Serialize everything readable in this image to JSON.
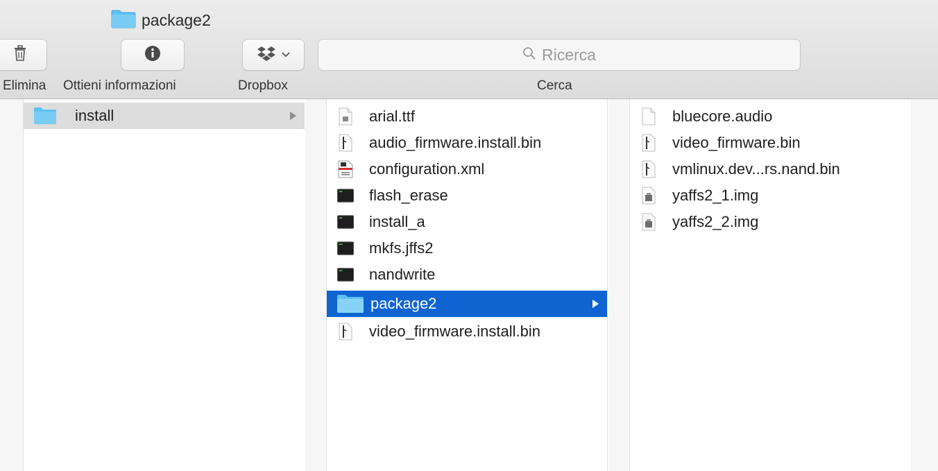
{
  "window": {
    "title": "package2",
    "title_icon": "folder-icon"
  },
  "toolbar": {
    "delete": {
      "label": "Elimina",
      "icon": "trash-icon"
    },
    "info": {
      "label": "Ottieni informazioni",
      "icon": "info-icon"
    },
    "dropbox": {
      "label": "Dropbox",
      "icon": "dropbox-icon"
    },
    "search": {
      "placeholder": "Ricerca",
      "label": "Cerca",
      "icon": "search-icon"
    }
  },
  "columns": [
    {
      "items": [
        {
          "name": "install",
          "kind": "folder",
          "selected": "inactive"
        }
      ]
    },
    {
      "items": [
        {
          "name": "arial.ttf",
          "kind": "font"
        },
        {
          "name": "audio_firmware.install.bin",
          "kind": "binary"
        },
        {
          "name": "configuration.xml",
          "kind": "xml"
        },
        {
          "name": "flash_erase",
          "kind": "exec"
        },
        {
          "name": "install_a",
          "kind": "exec"
        },
        {
          "name": "mkfs.jffs2",
          "kind": "exec"
        },
        {
          "name": "nandwrite",
          "kind": "exec"
        },
        {
          "name": "package2",
          "kind": "folder",
          "selected": "active"
        },
        {
          "name": "video_firmware.install.bin",
          "kind": "binary"
        }
      ]
    },
    {
      "items": [
        {
          "name": "bluecore.audio",
          "kind": "blank"
        },
        {
          "name": "video_firmware.bin",
          "kind": "binary"
        },
        {
          "name": "vmlinux.dev...rs.nand.bin",
          "kind": "binary"
        },
        {
          "name": "yaffs2_1.img",
          "kind": "image"
        },
        {
          "name": "yaffs2_2.img",
          "kind": "image"
        }
      ]
    }
  ],
  "colors": {
    "selection": "#0f64d2",
    "inactive_selection": "#dcdcdc",
    "folder": "#5ec0f2"
  }
}
